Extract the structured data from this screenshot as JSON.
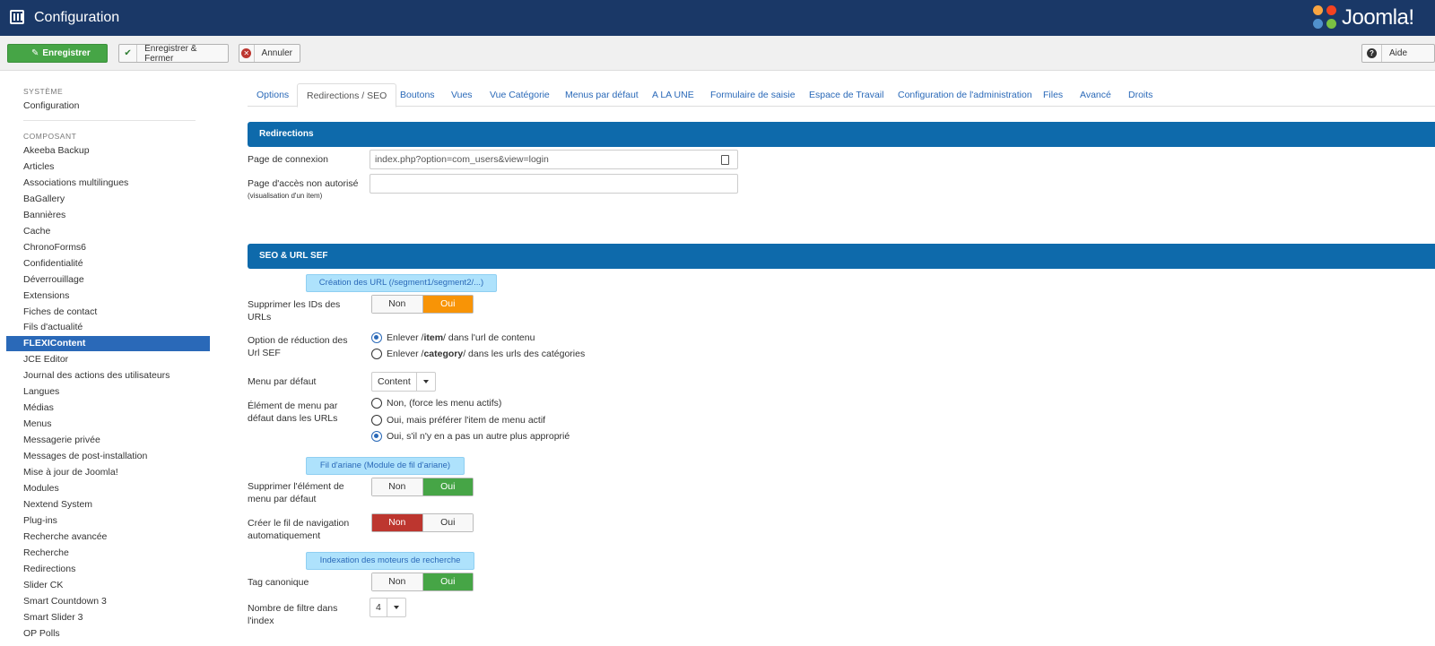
{
  "header": {
    "title": "Configuration",
    "logo_text": "Joomla!"
  },
  "toolbar": {
    "save_label": "Enregistrer",
    "save_close_label": "Enregistrer & Fermer",
    "cancel_label": "Annuler",
    "help_label": "Aide"
  },
  "sidebar": {
    "system_heading": "SYSTÈME",
    "system_items": [
      "Configuration"
    ],
    "component_heading": "COMPOSANT",
    "items": [
      "Akeeba Backup",
      "Articles",
      "Associations multilingues",
      "BaGallery",
      "Bannières",
      "Cache",
      "ChronoForms6",
      "Confidentialité",
      "Déverrouillage",
      "Extensions",
      "Fiches de contact",
      "Fils d'actualité",
      "FLEXIContent",
      "JCE Editor",
      "Journal des actions des utilisateurs",
      "Langues",
      "Médias",
      "Menus",
      "Messagerie privée",
      "Messages de post-installation",
      "Mise à jour de Joomla!",
      "Modules",
      "Nextend System",
      "Plug-ins",
      "Recherche avancée",
      "Recherche",
      "Redirections",
      "Slider CK",
      "Smart Countdown 3",
      "Smart Slider 3",
      "OP Polls"
    ],
    "active_index": 12
  },
  "tabs": [
    "Options",
    "Redirections / SEO",
    "Boutons",
    "Vues",
    "Vue Catégorie",
    "Menus par défaut",
    "A LA UNE",
    "Formulaire de saisie",
    "Espace de Travail",
    "Configuration de l'administration",
    "Files",
    "Avancé",
    "Droits"
  ],
  "active_tab": 1,
  "redirections": {
    "heading": "Redirections",
    "login_label": "Page de connexion",
    "login_value": "index.php?option=com_users&view=login",
    "unauth_label": "Page d'accès non autorisé",
    "unauth_note": "(visualisation d'un item)",
    "unauth_value": ""
  },
  "seo": {
    "heading": "SEO & URL SEF",
    "url_sub": "Création des URL (/segment1/segment2/...)",
    "remove_ids_label": "Supprimer les IDs des URLs",
    "toggle_no": "Non",
    "toggle_yes": "Oui",
    "reduce_label": "Option de réduction des Url SEF",
    "reduce_opt1_pre": "Enlever /",
    "reduce_opt1_bold": "item",
    "reduce_opt1_post": "/ dans l'url de contenu",
    "reduce_opt2_pre": "Enlever /",
    "reduce_opt2_bold": "category",
    "reduce_opt2_post": "/ dans les urls des catégories",
    "default_menu_label": "Menu par défaut",
    "default_menu_value": "Content",
    "default_item_label": "Élément de menu par défaut dans les URLs",
    "default_item_opts": [
      "Non, (force les menu actifs)",
      "Oui, mais préférer l'item de menu actif",
      "Oui, s'il n'y en a pas un autre plus approprié"
    ],
    "default_item_selected": 2,
    "breadcrumb_sub": "Fil d'ariane (Module de fil d'ariane)",
    "remove_menu_item_label": "Supprimer l'élément de menu par défaut",
    "auto_breadcrumb_label": "Créer le fil de navigation automatiquement",
    "indexing_sub": "Indexation des moteurs de recherche",
    "canonical_label": "Tag canonique",
    "filter_count_label": "Nombre de filtre dans l'index",
    "filter_count_value": "4"
  },
  "colors": {
    "header": "#1a3867",
    "section": "#0e6aab",
    "active": "#2a69b8",
    "green": "#46a546",
    "orange": "#f89406",
    "red": "#bd362f"
  }
}
